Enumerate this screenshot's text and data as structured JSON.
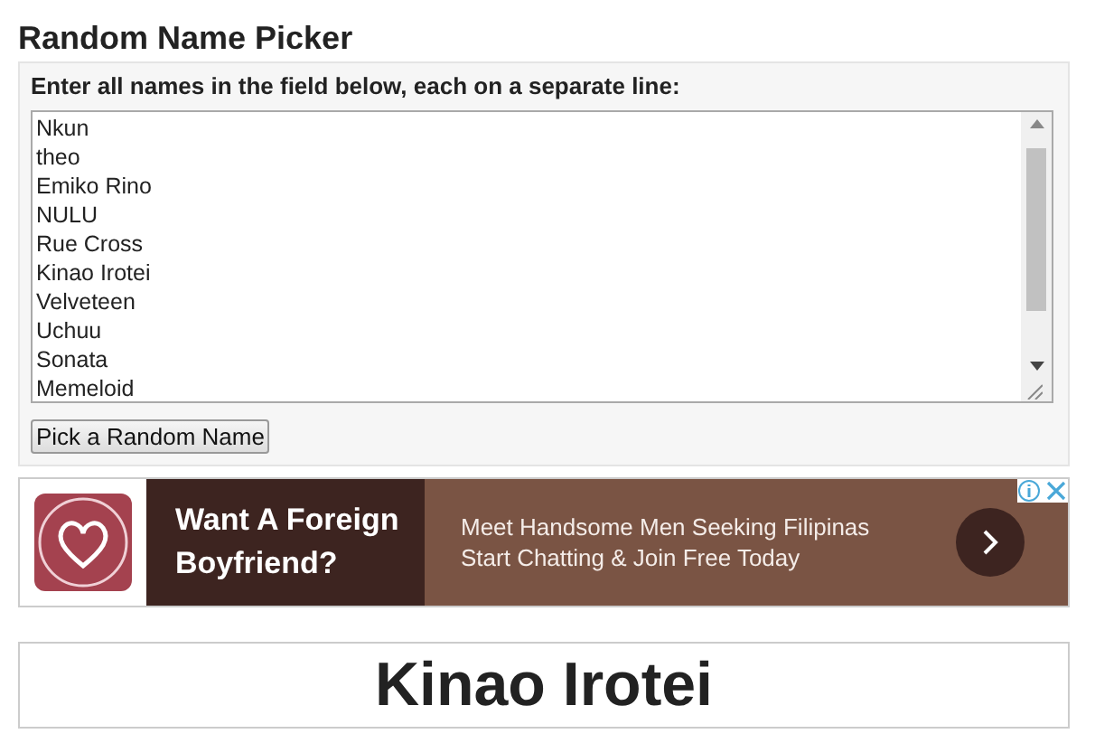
{
  "title": "Random Name Picker",
  "instructions": "Enter all names in the field below, each on a separate line:",
  "names": [
    "Nkun",
    "theo",
    "Emiko Rino",
    "NULU",
    "Rue Cross",
    "Kinao Irotei",
    "Velveteen",
    "Uchuu",
    "Sonata",
    "Memeloid"
  ],
  "pick_button": "Pick a Random Name",
  "ad": {
    "headline_1": "Want A Foreign",
    "headline_2": "Boyfriend?",
    "line_1": "Meet Handsome Men Seeking Filipinas",
    "line_2": "Start Chatting & Join Free Today"
  },
  "result": "Kinao Irotei"
}
